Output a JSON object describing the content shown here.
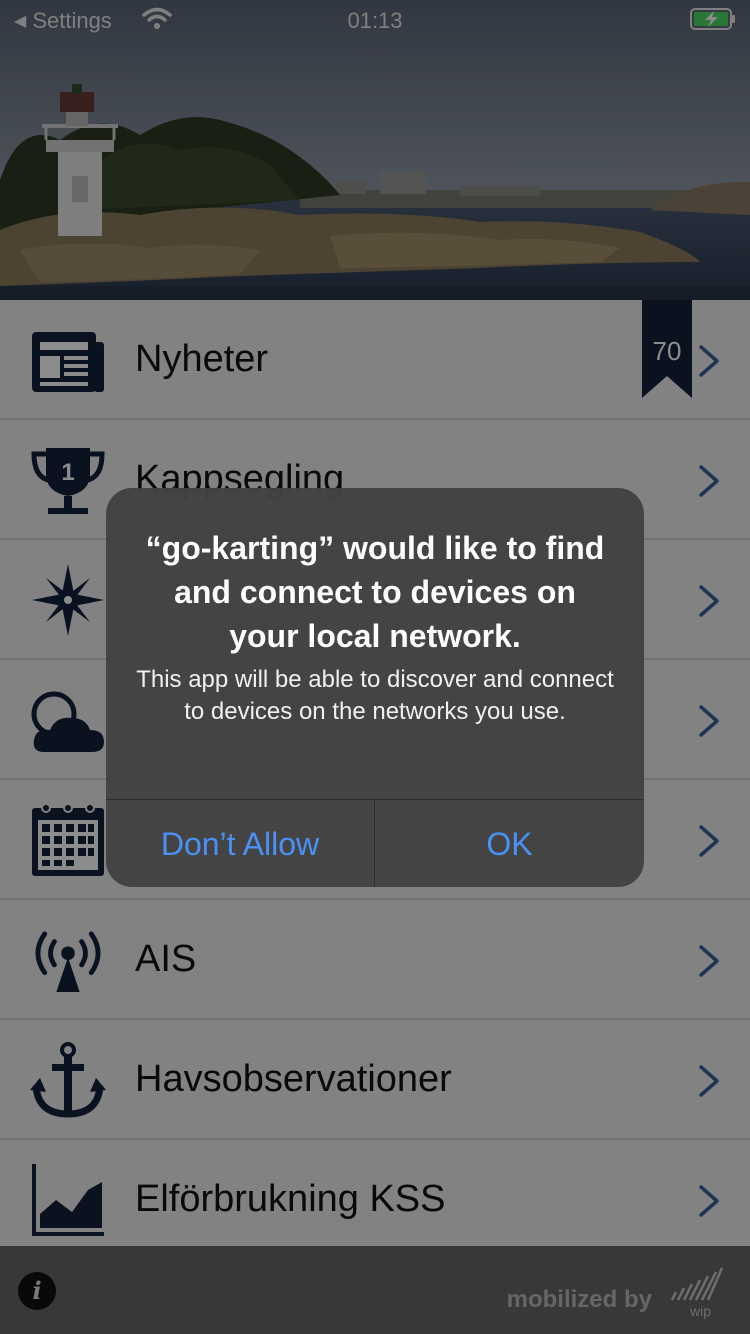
{
  "status_bar": {
    "back_label": "Settings",
    "time": "01:13"
  },
  "menu": {
    "items": [
      {
        "label": "Nyheter",
        "icon": "newspaper-icon",
        "badge": "70"
      },
      {
        "label": "Kappsegling",
        "icon": "trophy-icon"
      },
      {
        "label": "",
        "icon": "compass-rose-icon"
      },
      {
        "label": "",
        "icon": "weather-cloud-icon"
      },
      {
        "label": "",
        "icon": "calendar-icon"
      },
      {
        "label": "AIS",
        "icon": "radio-tower-icon"
      },
      {
        "label": "Havsobservationer",
        "icon": "anchor-icon"
      },
      {
        "label": "Elförbrukning KSS",
        "icon": "area-chart-icon"
      }
    ]
  },
  "bottom_bar": {
    "info_label": "i",
    "mobilized_label": "mobilized by",
    "logo_text": "wip"
  },
  "alert": {
    "title": "“go-karting” would like to find and connect to devices on your local network.",
    "message": "This app will be able to discover and connect to devices on the networks you use.",
    "dont_allow_label": "Don’t Allow",
    "ok_label": "OK"
  },
  "colors": {
    "icon_navy": "#13203a",
    "alert_button_blue": "#4a90f5",
    "chevron_blue": "#3c5f96"
  }
}
